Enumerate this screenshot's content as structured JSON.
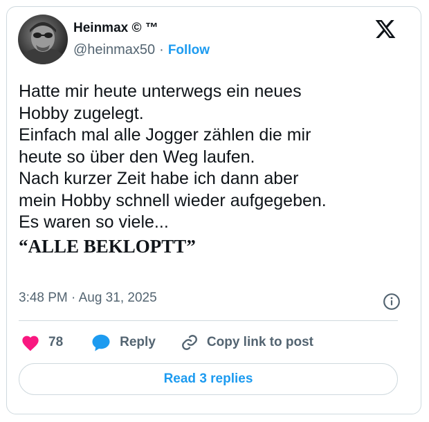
{
  "author": {
    "name": "Heinmax © ™",
    "handle": "@heinmax50",
    "separator": "·",
    "follow_label": "Follow"
  },
  "tweet": {
    "lines": [
      "Hatte mir heute unterwegs ein neues",
      "Hobby zugelegt.",
      "Einfach mal alle Jogger zählen die mir",
      "heute so über den Weg laufen.",
      "Nach kurzer Zeit habe ich dann aber",
      "mein Hobby schnell wieder aufgegeben.",
      "Es waren so viele..."
    ],
    "shout": "“ALLE BEKLOPTT”"
  },
  "meta": {
    "timestamp": "3:48 PM · Aug 31, 2025"
  },
  "actions": {
    "likes_count": "78",
    "reply_label": "Reply",
    "copy_link_label": "Copy link to post"
  },
  "footer": {
    "read_replies_label": "Read 3 replies"
  },
  "icons": {
    "logo": "x-logo-icon",
    "info": "info-icon",
    "like": "heart-icon",
    "reply": "speech-bubble-icon",
    "copy": "link-icon"
  },
  "colors": {
    "accent": "#1d9bf0",
    "like": "#f91880",
    "text": "#0f1419",
    "secondary": "#536471",
    "border": "#cfd9de"
  }
}
